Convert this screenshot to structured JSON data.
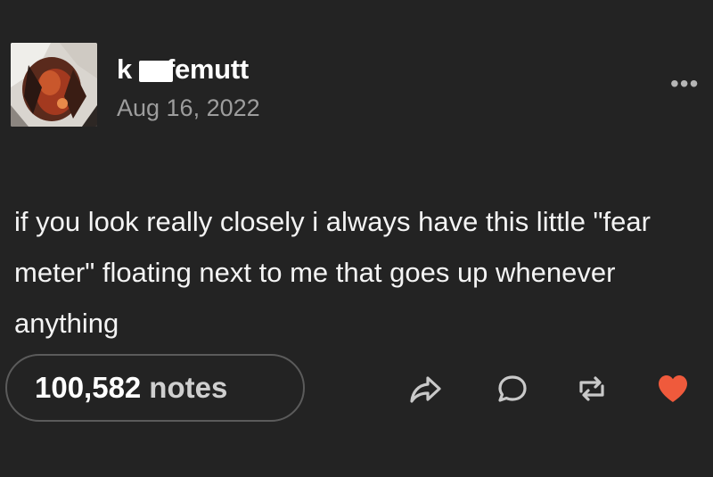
{
  "post": {
    "username": "knifemutt",
    "username_parts": {
      "before": "k",
      "after": "femutt"
    },
    "date": "Aug 16, 2022",
    "more_menu": "•••",
    "text": "if you look really closely i always have this little \"fear meter\" floating next to me that goes up whenever anything",
    "notes": {
      "count": "100,582",
      "label": "notes"
    }
  },
  "actions": {
    "share": "share-icon",
    "reply": "reply-icon",
    "reblog": "reblog-icon",
    "like": "heart-icon"
  },
  "colors": {
    "background": "#232323",
    "text": "#f4f4f4",
    "secondary_text": "#9d9d9d",
    "pill_border": "#5b5b5b",
    "like": "#ef5a3c"
  }
}
